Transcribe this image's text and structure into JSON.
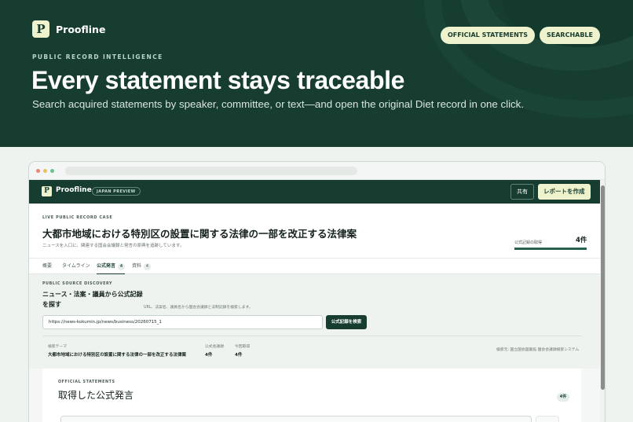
{
  "hero": {
    "brand_logo_letter": "P",
    "brand_name": "Proofline",
    "pills": [
      "OFFICIAL STATEMENTS",
      "SEARCHABLE"
    ],
    "eyebrow": "PUBLIC RECORD INTELLIGENCE",
    "title": "Every statement stays traceable",
    "subtitle": "Search acquired statements by speaker, committee, or text—and open the original Diet record in one click."
  },
  "app": {
    "logo_letter": "P",
    "name": "Proofline",
    "tag": "JAPAN PREVIEW",
    "share_label": "共有",
    "report_label": "レポートを作成"
  },
  "case": {
    "kicker": "LIVE PUBLIC RECORD CASE",
    "title": "大都市地域における特別区の設置に関する法律の一部を改正する法律案",
    "description": "ニュースを入口に、関連する国会会議録と発言の原典を追跡しています。",
    "stat_label": "公式記録の取得",
    "stat_value": "4件",
    "stat_progress": 1.0
  },
  "tabs": [
    {
      "label": "概要",
      "count": ""
    },
    {
      "label": "タイムライン",
      "count": ""
    },
    {
      "label": "公式発言",
      "count": "4",
      "active": true
    },
    {
      "label": "資料",
      "count": "4"
    }
  ],
  "discovery": {
    "kicker": "PUBLIC SOURCE DISCOVERY",
    "heading": "ニュース・法案・議員から公式記録を探す",
    "hint": "URL、法案名、議員名から国会会議録と法制記録を検索します。",
    "url_value": "https://news-kokumin.jp/news/business/20260715_1",
    "search_button": "公式記録を検索",
    "theme_label": "検索テーマ",
    "theme_value": "大都市地域における特別区の設置に関する法律の一部を改正する法律案",
    "records_label": "公式会議録",
    "records_value": "4件",
    "today_label": "今回取得",
    "today_value": "4件",
    "source": "検索元: 国立国会図書館 国会会議録検索システム"
  },
  "statements": {
    "kicker": "OFFICIAL STATEMENTS",
    "heading": "取得した公式発言",
    "count": "4件"
  }
}
